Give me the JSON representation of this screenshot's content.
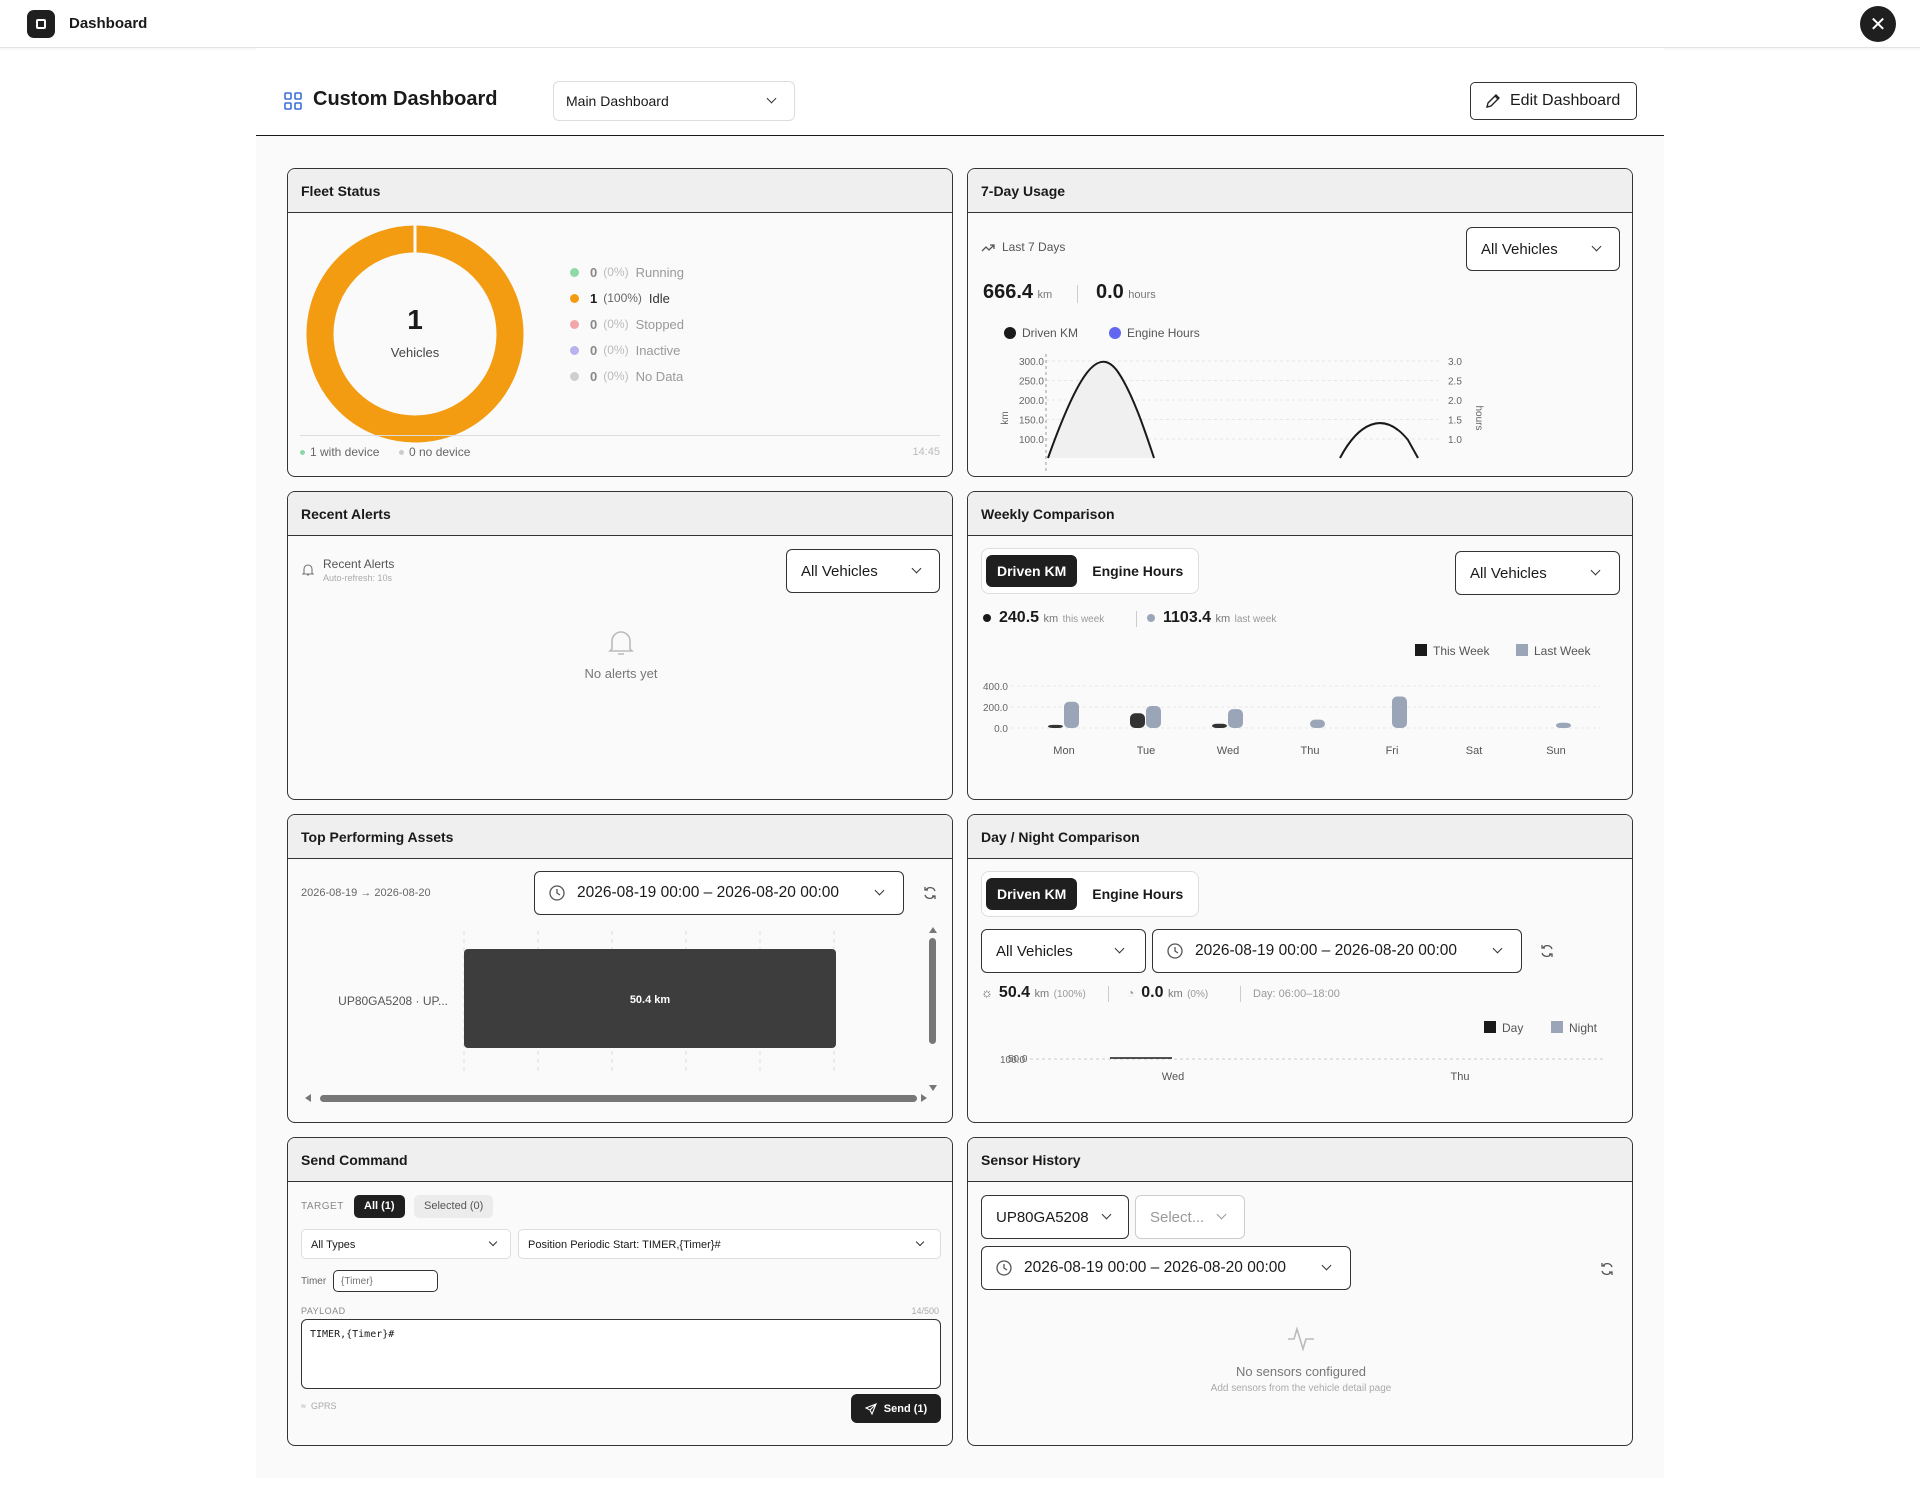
{
  "app": {
    "title": "Dashboard"
  },
  "header": {
    "title": "Custom Dashboard",
    "selected_dashboard": "Main Dashboard",
    "edit_label": "Edit Dashboard"
  },
  "fleet": {
    "title": "Fleet Status",
    "total": "1",
    "total_label": "Vehicles",
    "statuses": [
      {
        "count": "0",
        "pct": "(0%)",
        "label": "Running",
        "color": "#8fd9a8"
      },
      {
        "count": "1",
        "pct": "(100%)",
        "label": "Idle",
        "color": "#f39c12"
      },
      {
        "count": "0",
        "pct": "(0%)",
        "label": "Stopped",
        "color": "#f1a7a7"
      },
      {
        "count": "0",
        "pct": "(0%)",
        "label": "Inactive",
        "color": "#b6b3ee"
      },
      {
        "count": "0",
        "pct": "(0%)",
        "label": "No Data",
        "color": "#cfcfcf"
      }
    ],
    "with_device": "1 with device",
    "no_device": "0 no device",
    "time": "14:45"
  },
  "usage": {
    "title": "7-Day Usage",
    "period": "Last 7 Days",
    "vehicle_filter": "All Vehicles",
    "km_value": "666.4",
    "km_unit": "km",
    "hours_value": "0.0",
    "hours_unit": "hours",
    "legend_km": "Driven KM",
    "legend_hours": "Engine Hours",
    "left_axis_label": "km",
    "right_axis_label": "hours",
    "left_ticks": [
      "300.0",
      "250.0",
      "200.0",
      "150.0",
      "100.0"
    ],
    "right_ticks": [
      "3.0",
      "2.5",
      "2.0",
      "1.5",
      "1.0"
    ]
  },
  "alerts": {
    "title": "Recent Alerts",
    "subtitle": "Recent Alerts",
    "refresh": "Auto-refresh: 10s",
    "vehicle_filter": "All Vehicles",
    "empty": "No alerts yet"
  },
  "weekly": {
    "title": "Weekly Comparison",
    "tab_km": "Driven KM",
    "tab_hours": "Engine Hours",
    "vehicle_filter": "All Vehicles",
    "this_value": "240.5",
    "this_unit": "km",
    "this_label": "this week",
    "last_value": "1103.4",
    "last_unit": "km",
    "last_label": "last week",
    "legend_this": "This Week",
    "legend_last": "Last Week",
    "y_ticks": [
      "400.0",
      "200.0",
      "0.0"
    ]
  },
  "assets": {
    "title": "Top Performing Assets",
    "range_label": "2026-08-19 → 2026-08-20",
    "date_range": "2026-08-19 00:00 – 2026-08-20 00:00"
  },
  "daynight": {
    "title": "Day / Night Comparison",
    "tab_km": "Driven KM",
    "tab_hours": "Engine Hours",
    "vehicle_filter": "All Vehicles",
    "date_range": "2026-08-19 00:00 – 2026-08-20 00:00",
    "day_value": "50.4",
    "day_unit": "km",
    "day_pct": "(100%)",
    "night_value": "0.0",
    "night_unit": "km",
    "night_pct": "(0%)",
    "day_window": "Day: 06:00–18:00",
    "legend_day": "Day",
    "legend_night": "Night",
    "y_tick_a": "100.0",
    "y_tick_b": "50.0",
    "x_ticks": [
      "Wed",
      "Thu"
    ]
  },
  "command": {
    "title": "Send Command",
    "target_label": "TARGET",
    "all_btn": "All (1)",
    "selected_btn": "Selected (0)",
    "type_filter": "All Types",
    "command": "Position Periodic Start: TIMER,{Timer}#",
    "timer_label": "Timer",
    "timer_placeholder": "{Timer}",
    "payload_label": "PAYLOAD",
    "payload_count": "14/500",
    "payload": "TIMER,{Timer}#",
    "channel": "GPRS",
    "send_label": "Send (1)"
  },
  "sensor": {
    "title": "Sensor History",
    "vehicle": "UP80GA5208",
    "sensor_placeholder": "Select...",
    "date_range": "2026-08-19 00:00 – 2026-08-20 00:00",
    "empty": "No sensors configured",
    "empty_hint": "Add sensors from the vehicle detail page"
  },
  "chart_data": [
    {
      "type": "line",
      "title": "7-Day Usage",
      "ylabel": "km",
      "y2label": "hours",
      "ylim": [
        100,
        300
      ],
      "y2lim": [
        1.0,
        3.0
      ],
      "series": [
        {
          "name": "Driven KM",
          "color": "#1a1a1a"
        },
        {
          "name": "Engine Hours",
          "color": "#6366f1"
        }
      ]
    },
    {
      "type": "bar",
      "title": "Weekly Comparison",
      "categories": [
        "Mon",
        "Tue",
        "Wed",
        "Thu",
        "Fri",
        "Sat",
        "Sun"
      ],
      "ylim": [
        0,
        400
      ],
      "series": [
        {
          "name": "This Week",
          "color": "#333333",
          "values": [
            15,
            70,
            20,
            0,
            0,
            0,
            0
          ]
        },
        {
          "name": "Last Week",
          "color": "#9aa6b8",
          "values": [
            125,
            105,
            90,
            40,
            150,
            0,
            25
          ]
        }
      ]
    },
    {
      "type": "bar",
      "title": "Top Performing Assets",
      "orientation": "horizontal",
      "categories": [
        "UP80GA5208 · UP..."
      ],
      "values": [
        50.4
      ],
      "value_labels": [
        "50.4 km"
      ]
    },
    {
      "type": "bar",
      "title": "Day / Night Comparison",
      "categories": [
        "Wed",
        "Thu"
      ],
      "series": [
        {
          "name": "Day",
          "color": "#1a1a1a",
          "values": [
            50.4,
            0
          ]
        },
        {
          "name": "Night",
          "color": "#9aa6b8",
          "values": [
            0,
            0
          ]
        }
      ]
    }
  ]
}
